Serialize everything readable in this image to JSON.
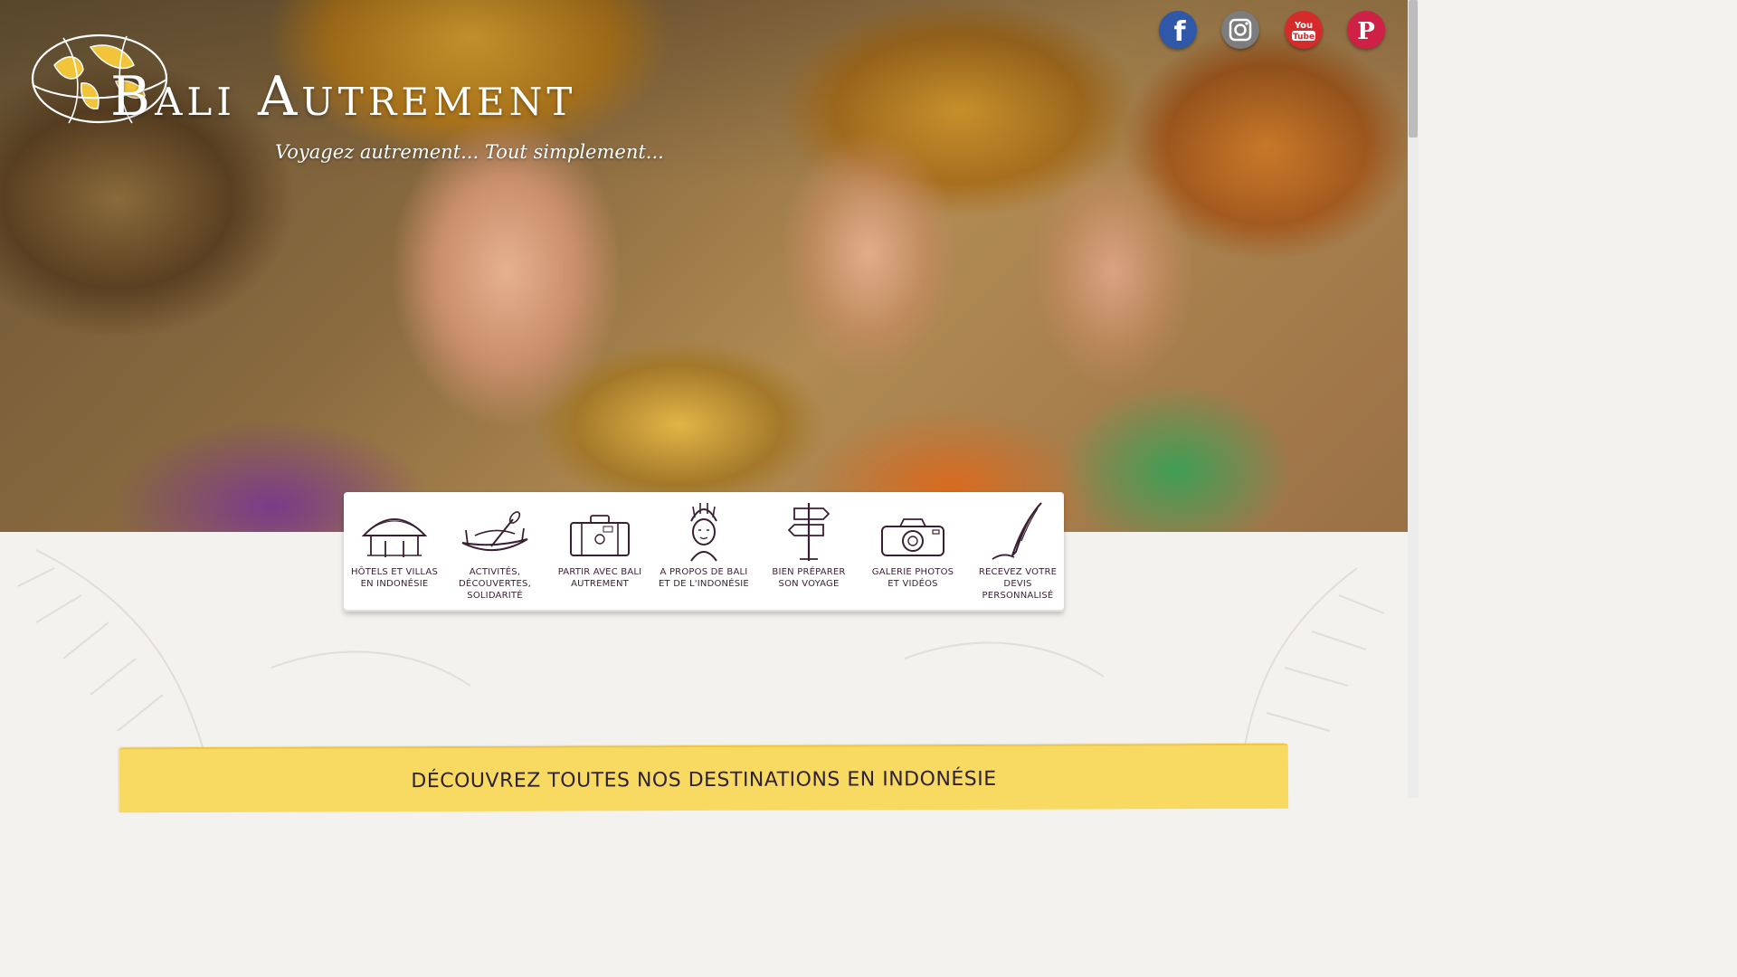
{
  "header": {
    "site_title": "Bali Autrement",
    "tagline": "Voyagez autrement... Tout simplement..."
  },
  "social": [
    {
      "name": "Facebook",
      "icon": "facebook-icon",
      "color": "#2f58a8",
      "glyph": "f"
    },
    {
      "name": "Instagram",
      "icon": "instagram-icon",
      "color": "#7d7d7d"
    },
    {
      "name": "YouTube",
      "icon": "youtube-icon",
      "color": "#d52b2b",
      "label_top": "You",
      "label_bottom": "Tube"
    },
    {
      "name": "Pinterest",
      "icon": "pinterest-icon",
      "color": "#cf2046",
      "glyph": "P"
    }
  ],
  "nav": {
    "items": [
      {
        "label": "Hôtels et villas en Indonésie",
        "icon": "hut-icon"
      },
      {
        "label": "Activités, découvertes, solidarité",
        "icon": "canoe-icon"
      },
      {
        "label": "Partir avec Bali Autrement",
        "icon": "suitcase-icon"
      },
      {
        "label": "A propos de Bali et de l'Indonésie",
        "icon": "balinese-dancer-icon"
      },
      {
        "label": "Bien préparer son voyage",
        "icon": "signpost-icon"
      },
      {
        "label": "Galerie photos et vidéos",
        "icon": "camera-icon"
      },
      {
        "label": "Recevez votre devis personnalisé",
        "icon": "quill-pen-icon"
      }
    ]
  },
  "banner": {
    "title": "Découvrez toutes nos destinations en Indonésie",
    "subtitle": ""
  },
  "colors": {
    "nav_text": "#3a1f33",
    "banner_bg": "#f8da63",
    "banner_text": "#2d2236"
  }
}
